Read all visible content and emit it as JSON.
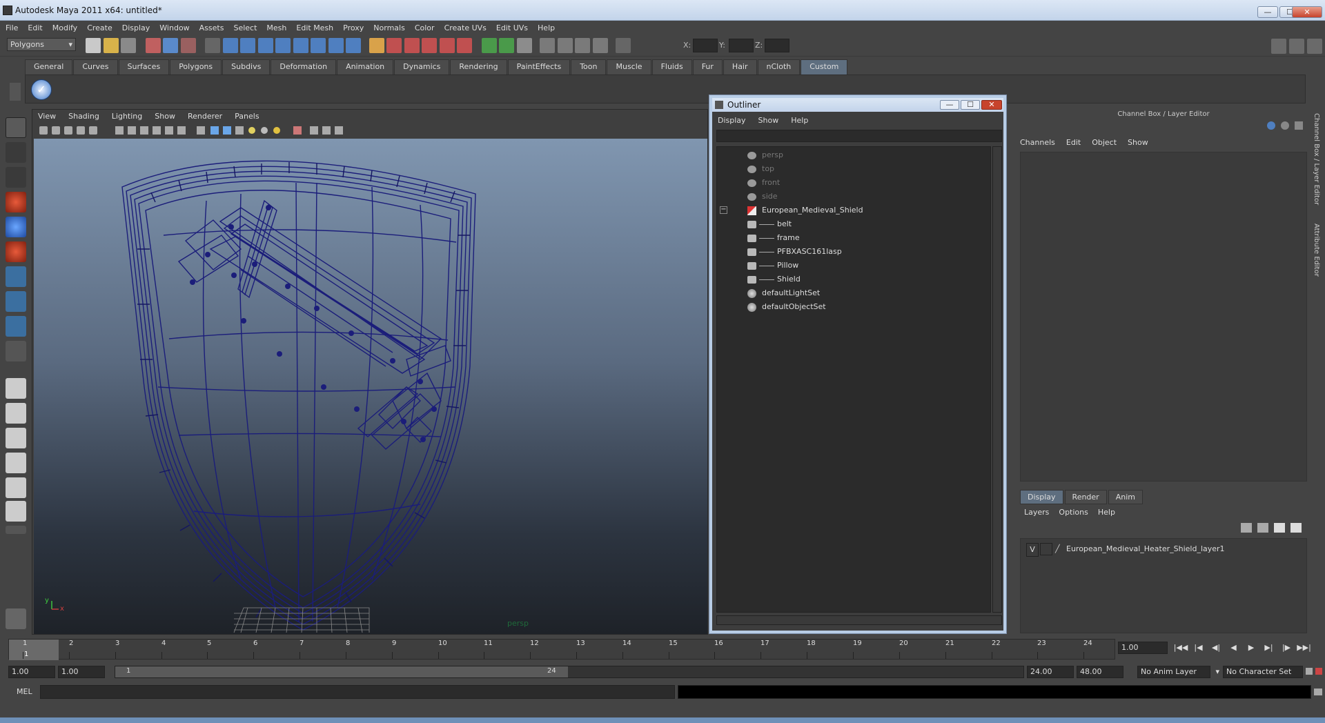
{
  "window": {
    "title": "Autodesk Maya 2011 x64: untitled*",
    "buttons": [
      "—",
      "☐",
      "✕"
    ]
  },
  "menubar": [
    "File",
    "Edit",
    "Modify",
    "Create",
    "Display",
    "Window",
    "Assets",
    "Select",
    "Mesh",
    "Edit Mesh",
    "Proxy",
    "Normals",
    "Color",
    "Create UVs",
    "Edit UVs",
    "Help"
  ],
  "statusline": {
    "menu_set": "Polygons",
    "x_label": "X:",
    "y_label": "Y:",
    "z_label": "Z:"
  },
  "shelf": {
    "tabs": [
      "General",
      "Curves",
      "Surfaces",
      "Polygons",
      "Subdivs",
      "Deformation",
      "Animation",
      "Dynamics",
      "Rendering",
      "PaintEffects",
      "Toon",
      "Muscle",
      "Fluids",
      "Fur",
      "Hair",
      "nCloth",
      "Custom"
    ],
    "active_tab": "Custom"
  },
  "viewport": {
    "menu": [
      "View",
      "Shading",
      "Lighting",
      "Show",
      "Renderer",
      "Panels"
    ],
    "camera_label": "persp",
    "axis_y": "y",
    "axis_x": "x",
    "wire_color": "#1b1d7a"
  },
  "outliner": {
    "title": "Outliner",
    "menu": [
      "Display",
      "Show",
      "Help"
    ],
    "items": [
      {
        "label": "persp",
        "type": "camera",
        "dim": true
      },
      {
        "label": "top",
        "type": "camera",
        "dim": true
      },
      {
        "label": "front",
        "type": "camera",
        "dim": true
      },
      {
        "label": "side",
        "type": "camera",
        "dim": true
      },
      {
        "label": "European_Medieval_Shield",
        "type": "group",
        "expanded": true
      },
      {
        "label": "belt",
        "type": "mesh",
        "child": true
      },
      {
        "label": "frame",
        "type": "mesh",
        "child": true
      },
      {
        "label": "PFBXASC161lasp",
        "type": "mesh",
        "child": true
      },
      {
        "label": "Pillow",
        "type": "mesh",
        "child": true
      },
      {
        "label": "Shield",
        "type": "mesh",
        "child": true
      },
      {
        "label": "defaultLightSet",
        "type": "set"
      },
      {
        "label": "defaultObjectSet",
        "type": "set"
      }
    ],
    "collapse_symbol": "−"
  },
  "channelbox": {
    "header": "Channel Box / Layer Editor",
    "menu": [
      "Channels",
      "Edit",
      "Object",
      "Show"
    ],
    "layer_tabs": [
      "Display",
      "Render",
      "Anim"
    ],
    "active_layer_tab": "Display",
    "layer_menu": [
      "Layers",
      "Options",
      "Help"
    ],
    "layers": [
      {
        "visible": "V",
        "name": "European_Medieval_Heater_Shield_layer1"
      }
    ],
    "side_tabs": [
      "Channel Box / Layer Editor",
      "Attribute Editor"
    ]
  },
  "timeline": {
    "ticks": [
      "1",
      "2",
      "3",
      "4",
      "5",
      "6",
      "7",
      "8",
      "9",
      "10",
      "11",
      "12",
      "13",
      "14",
      "15",
      "16",
      "17",
      "18",
      "19",
      "20",
      "21",
      "22",
      "23",
      "24"
    ],
    "current_frame_marker": "1",
    "current_time": "1.00",
    "playback_glyphs": [
      "|◀◀",
      "|◀",
      "◀|",
      "◀",
      "▶",
      "▶|",
      "|▶",
      "▶▶|"
    ]
  },
  "range": {
    "start_time": "1.00",
    "playback_start": "1.00",
    "slider_start": "1",
    "slider_end": "24",
    "playback_end": "24.00",
    "end_time": "48.00",
    "anim_layer": "No Anim Layer",
    "character_set": "No Character Set"
  },
  "commandline": {
    "label": "MEL"
  }
}
